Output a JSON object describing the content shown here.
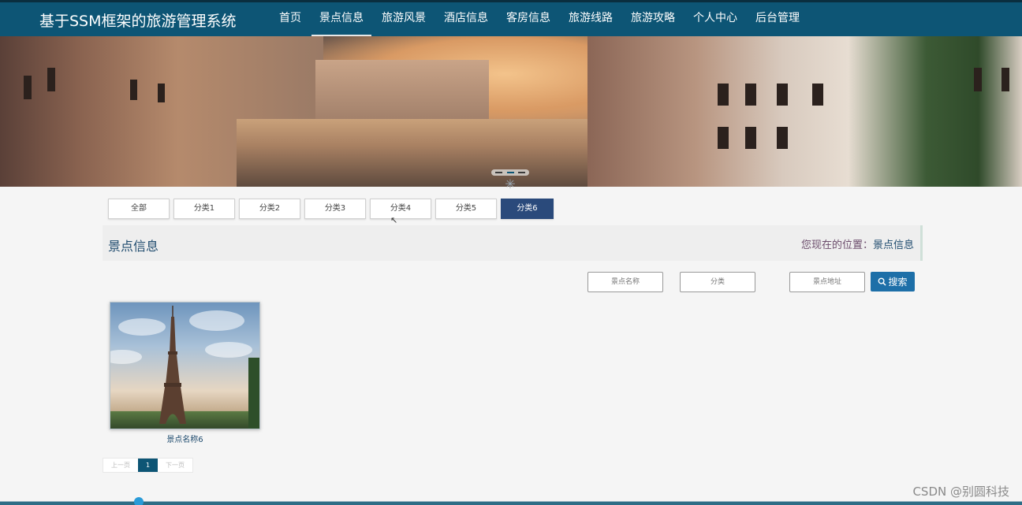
{
  "app_title": "基于SSM框架的旅游管理系统",
  "nav": {
    "items": [
      {
        "label": "首页",
        "active": false
      },
      {
        "label": "景点信息",
        "active": true
      },
      {
        "label": "旅游风景",
        "active": false
      },
      {
        "label": "酒店信息",
        "active": false
      },
      {
        "label": "客房信息",
        "active": false
      },
      {
        "label": "旅游线路",
        "active": false
      },
      {
        "label": "旅游攻略",
        "active": false
      },
      {
        "label": "个人中心",
        "active": false
      },
      {
        "label": "后台管理",
        "active": false
      }
    ]
  },
  "categories": [
    "全部",
    "分类1",
    "分类2",
    "分类3",
    "分类4",
    "分类5",
    "分类6"
  ],
  "selected_category": "分类6",
  "page": {
    "title": "景点信息",
    "location_prefix": "您现在的位置：",
    "location_current": "景点信息"
  },
  "search": {
    "name_placeholder": "景点名称",
    "category_placeholder": "分类",
    "address_placeholder": "景点地址",
    "button_label": "搜索"
  },
  "items": [
    {
      "name": "景点名称6"
    }
  ],
  "pagination": {
    "prev_label": "上一页",
    "current_page": "1",
    "next_label": "下一页"
  },
  "watermark": "CSDN @别圆科技",
  "colors": {
    "header_bg": "#0d5575",
    "selected_category_bg": "#2a4a7b",
    "search_button_bg": "#1d6fa8"
  }
}
